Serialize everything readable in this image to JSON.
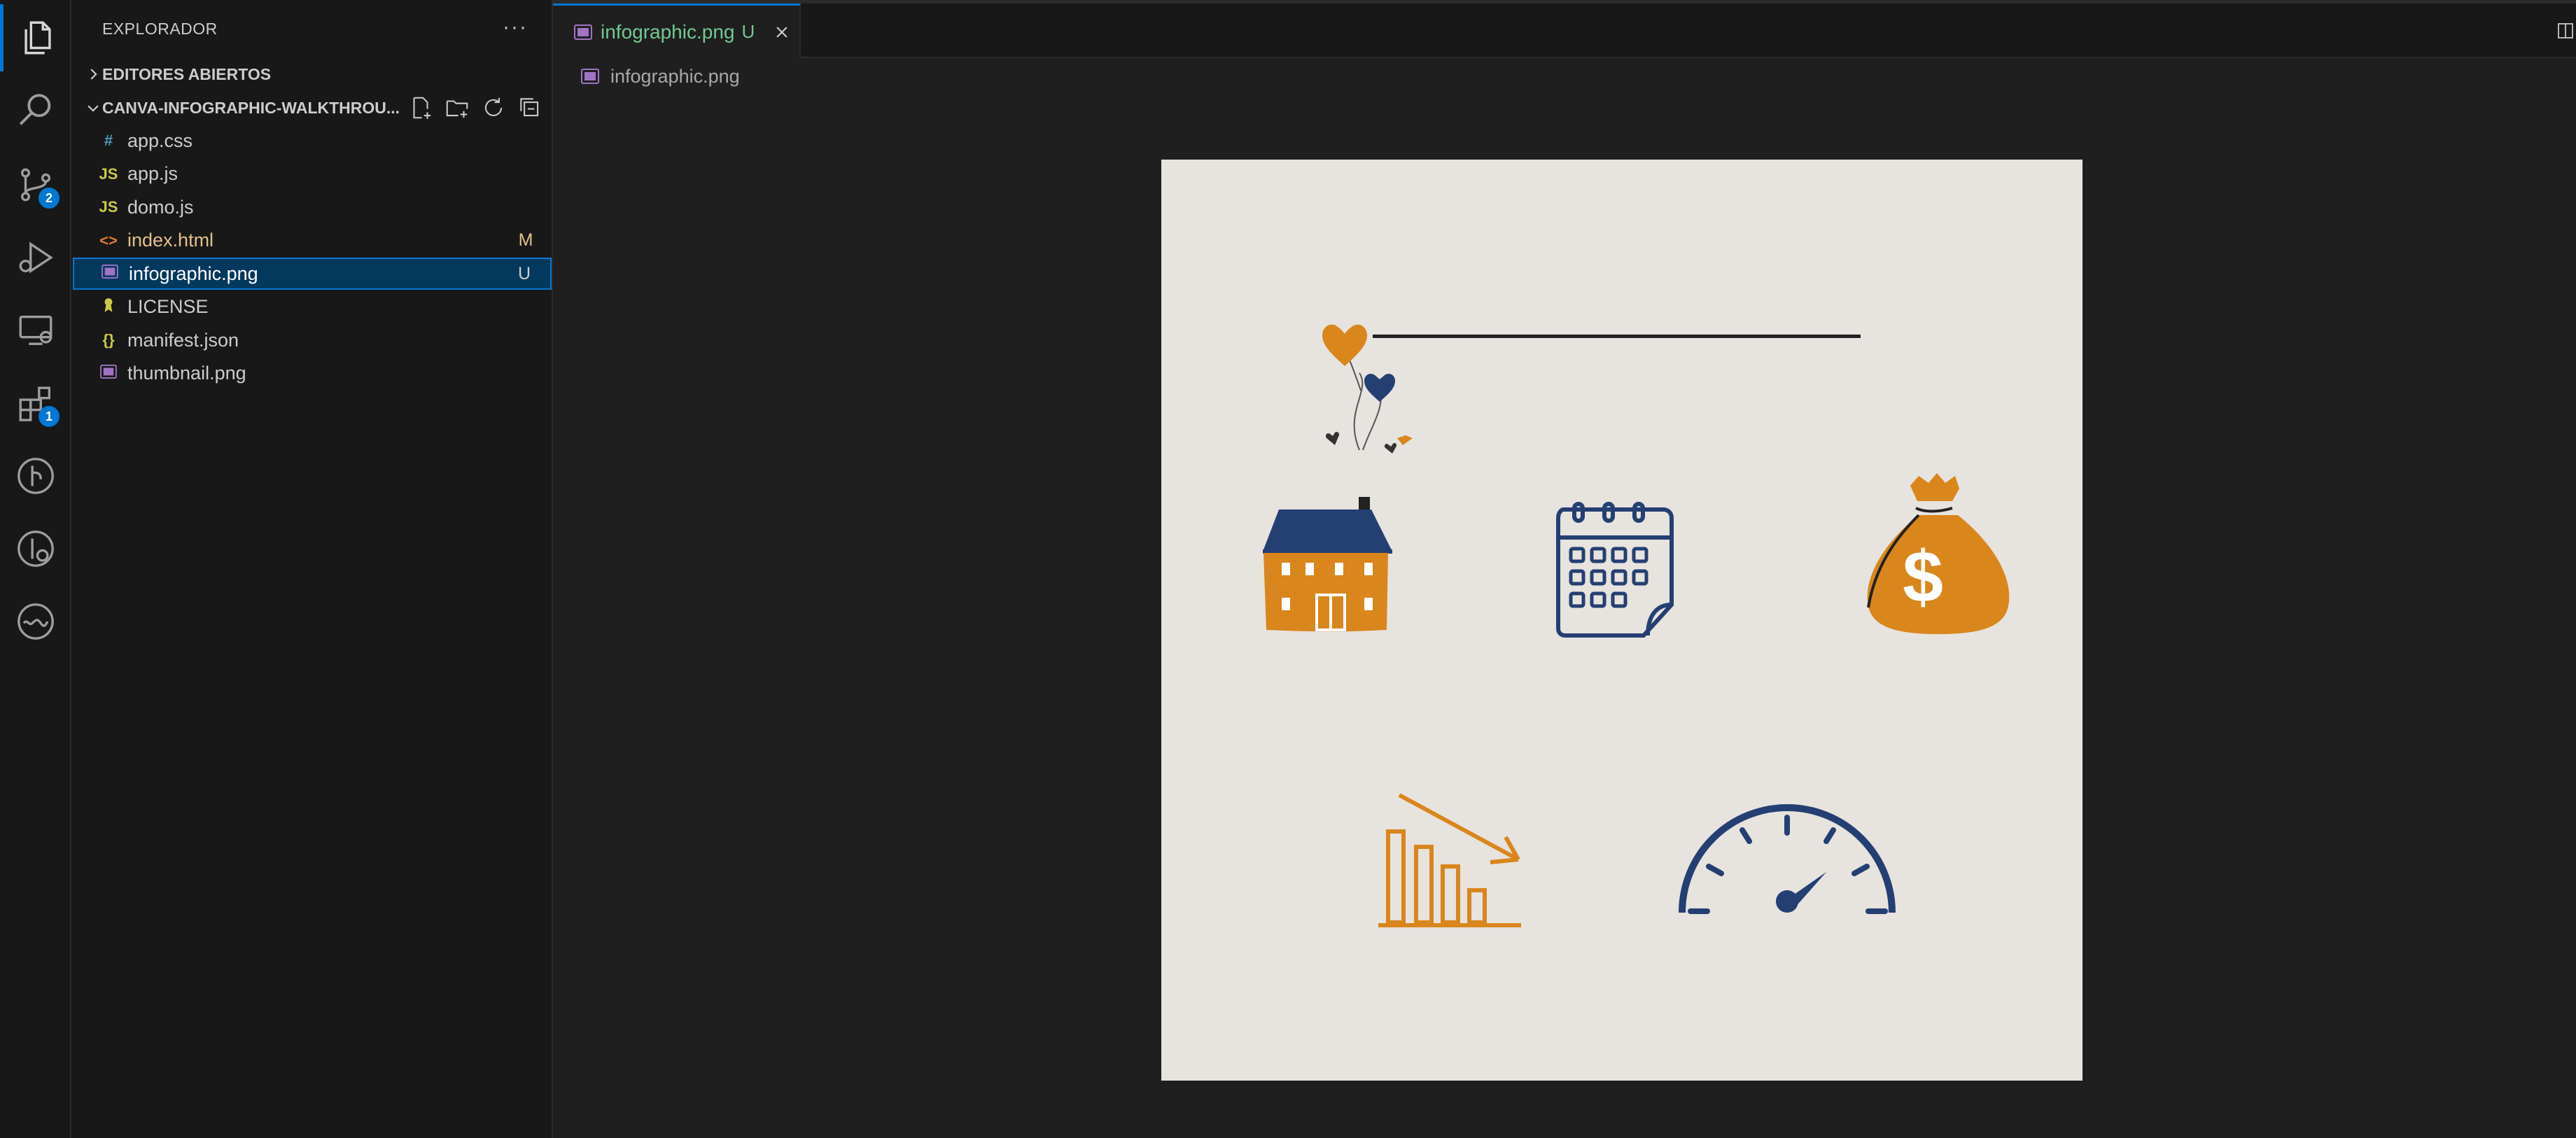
{
  "activity_bar": {
    "items": [
      {
        "icon": "files-icon",
        "active": true
      },
      {
        "icon": "search-icon"
      },
      {
        "icon": "source-control-icon",
        "badge": "2"
      },
      {
        "icon": "run-debug-icon"
      },
      {
        "icon": "remote-explorer-icon"
      },
      {
        "icon": "extensions-icon",
        "badge": "1"
      },
      {
        "icon": "git-graph-icon"
      },
      {
        "icon": "timeline-icon"
      },
      {
        "icon": "wave-icon"
      }
    ],
    "accent": "#0078d4"
  },
  "sidebar": {
    "title": "EXPLORADOR",
    "more": "···",
    "open_editors": "EDITORES ABIERTOS",
    "folder": "CANVA-INFOGRAPHIC-WALKTHROU...",
    "files": [
      {
        "name": "app.css",
        "icon": "#",
        "icon_color": "#519aba",
        "name_color": "#cccccc",
        "status": ""
      },
      {
        "name": "app.js",
        "icon": "JS",
        "icon_color": "#cbcb41",
        "name_color": "#cccccc",
        "status": ""
      },
      {
        "name": "domo.js",
        "icon": "JS",
        "icon_color": "#cbcb41",
        "name_color": "#cccccc",
        "status": ""
      },
      {
        "name": "index.html",
        "icon": "<>",
        "icon_color": "#e37933",
        "name_color": "#e2c08d",
        "status": "M",
        "status_color": "#e2c08d"
      },
      {
        "name": "infographic.png",
        "icon": "img",
        "icon_color": "#a074c4",
        "name_color": "#ffffff",
        "status": "U",
        "status_color": "#cccccc",
        "selected": true
      },
      {
        "name": "LICENSE",
        "icon": "lic",
        "icon_color": "#cbcb41",
        "name_color": "#cccccc",
        "status": ""
      },
      {
        "name": "manifest.json",
        "icon": "{}",
        "icon_color": "#cbcb41",
        "name_color": "#cccccc",
        "status": ""
      },
      {
        "name": "thumbnail.png",
        "icon": "img",
        "icon_color": "#a074c4",
        "name_color": "#cccccc",
        "status": ""
      }
    ]
  },
  "editor": {
    "tab": {
      "label": "infographic.png",
      "status": "U",
      "color": "#73c991"
    },
    "breadcrumb": "infographic.png",
    "image": {
      "background": "#e7e3de",
      "colors": {
        "orange": "#d9861c",
        "navy": "#243f72",
        "dark": "#222222",
        "white": "#ffffff"
      },
      "icons": [
        "house-with-hearts-icon",
        "calendar-icon",
        "money-bag-icon",
        "declining-bar-chart-icon",
        "speedometer-icon"
      ]
    }
  }
}
